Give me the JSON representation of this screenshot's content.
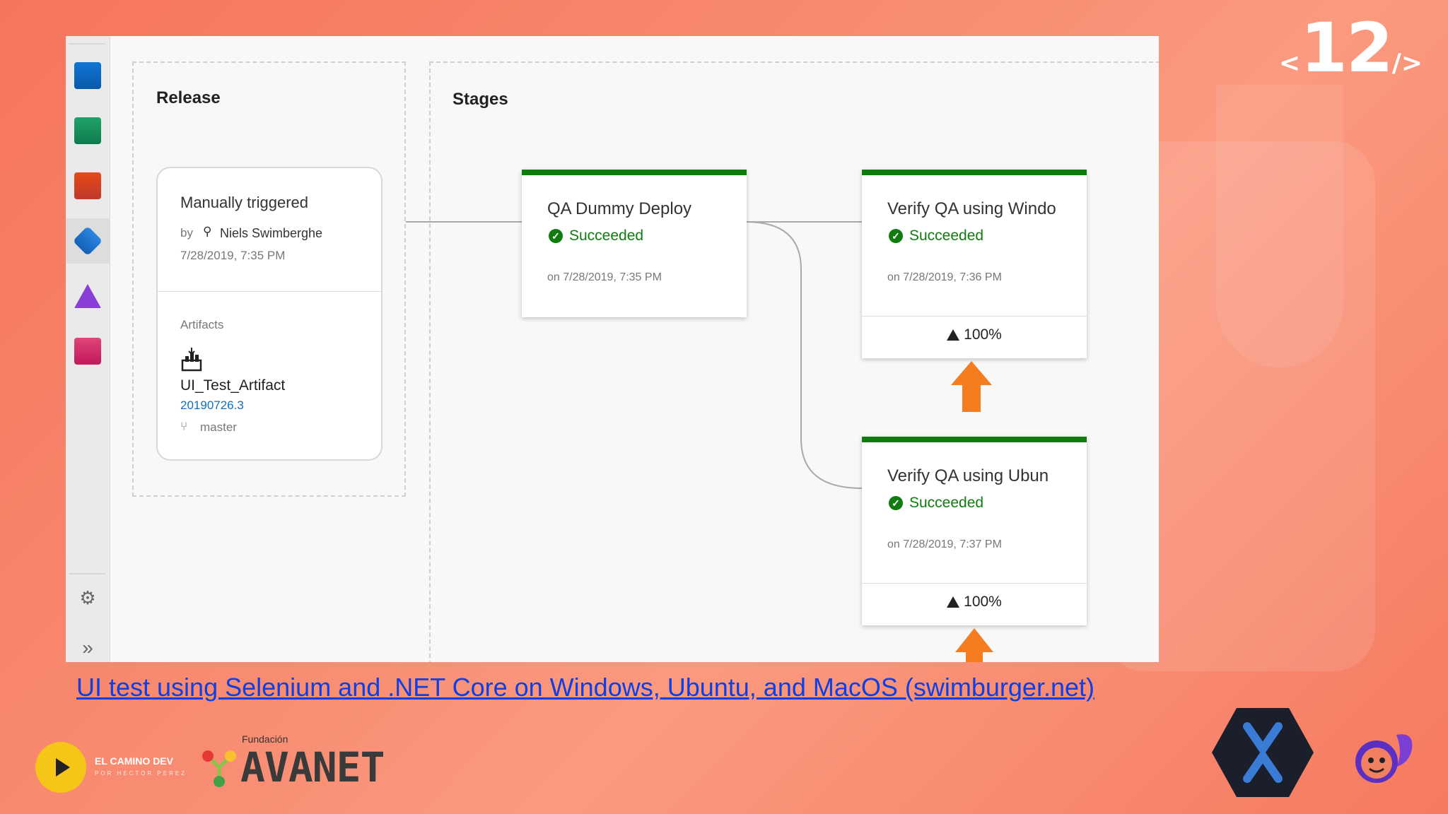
{
  "slide": {
    "number": "12",
    "open_bracket": "<",
    "close_bracket": "/>"
  },
  "sidebar": {
    "items": [
      {
        "icon": "boards-icon"
      },
      {
        "icon": "repos-check-icon"
      },
      {
        "icon": "git-branch-icon"
      },
      {
        "icon": "pipelines-icon",
        "active": true
      },
      {
        "icon": "test-plans-flask-icon"
      },
      {
        "icon": "artifacts-icon"
      }
    ],
    "settings_icon": "gear-icon",
    "expand_icon": "expand-chevrons-icon"
  },
  "release": {
    "title": "Release",
    "trigger": "Manually triggered",
    "by_label": "by",
    "user": "Niels Swimberghe",
    "date": "7/28/2019, 7:35 PM",
    "artifacts_label": "Artifacts",
    "artifact_name": "UI_Test_Artifact",
    "artifact_version": "20190726.3",
    "branch": "master"
  },
  "stages": {
    "title": "Stages",
    "items": [
      {
        "name": "QA Dummy Deploy",
        "status": "Succeeded",
        "date": "on 7/28/2019, 7:35 PM"
      },
      {
        "name": "Verify QA using Windo",
        "status": "Succeeded",
        "date": "on 7/28/2019, 7:36 PM",
        "tests": "100%"
      },
      {
        "name": "Verify QA using Ubun",
        "status": "Succeeded",
        "date": "on 7/28/2019, 7:37 PM",
        "tests": "100%"
      }
    ]
  },
  "link_text": "UI test using Selenium and .NET Core on Windows, Ubuntu, and MacOS (swimburger.net)",
  "logos": {
    "camino_title": "EL CAMINO DEV",
    "camino_sub": "POR HECTOR PEREZ",
    "avanet_small": "Fundación",
    "avanet_big": "AVANET"
  },
  "colors": {
    "success": "#107c10",
    "accent_orange": "#f57c1f",
    "link": "#0f3fe0"
  }
}
